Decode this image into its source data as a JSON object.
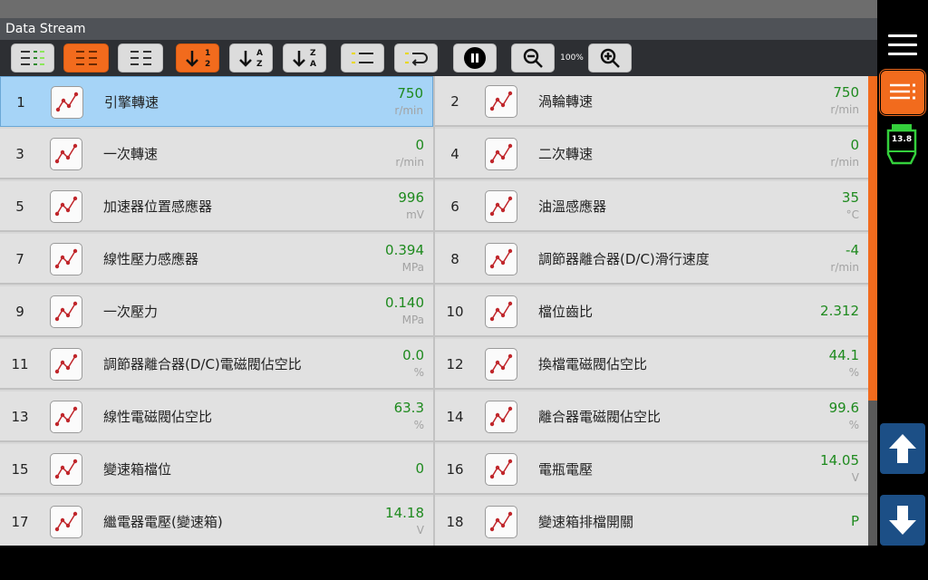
{
  "window": {
    "title": "Data Stream"
  },
  "toolbar": {
    "zoom": "100%",
    "buttons": [
      {
        "name": "view-list-3col-button",
        "icon": "three-column-list-icon",
        "active": false
      },
      {
        "name": "view-list-2col-button",
        "icon": "two-column-list-icon",
        "active": true
      },
      {
        "name": "view-list-compact-button",
        "icon": "compact-list-icon",
        "active": false
      },
      {
        "name": "sort-numeric-button",
        "icon": "sort-numeric-icon",
        "active": true
      },
      {
        "name": "sort-az-button",
        "icon": "sort-az-icon",
        "active": false
      },
      {
        "name": "sort-za-button",
        "icon": "sort-za-icon",
        "active": false
      },
      {
        "name": "select-items-button",
        "icon": "checklist-icon",
        "active": false
      },
      {
        "name": "undo-selection-button",
        "icon": "undo-list-icon",
        "active": false
      },
      {
        "name": "pause-button",
        "icon": "pause-icon",
        "active": false
      },
      {
        "name": "zoom-out-button",
        "icon": "zoom-out-icon",
        "active": false
      },
      {
        "name": "zoom-in-button",
        "icon": "zoom-in-icon",
        "active": false
      }
    ]
  },
  "colors": {
    "accent": "#f26b1d",
    "value_green": "#1e8a1e",
    "selected_row": "#a6d4f7",
    "nav_blue": "#1c4f86"
  },
  "rows": [
    {
      "num": "1",
      "name": "引擎轉速",
      "value": "750",
      "unit": "r/min",
      "selected": true
    },
    {
      "num": "2",
      "name": "渦輪轉速",
      "value": "750",
      "unit": "r/min"
    },
    {
      "num": "3",
      "name": "一次轉速",
      "value": "0",
      "unit": "r/min"
    },
    {
      "num": "4",
      "name": "二次轉速",
      "value": "0",
      "unit": "r/min"
    },
    {
      "num": "5",
      "name": "加速器位置感應器",
      "value": "996",
      "unit": "mV"
    },
    {
      "num": "6",
      "name": "油溫感應器",
      "value": "35",
      "unit": "°C"
    },
    {
      "num": "7",
      "name": "線性壓力感應器",
      "value": "0.394",
      "unit": "MPa"
    },
    {
      "num": "8",
      "name": "調節器離合器(D/C)滑行速度",
      "value": "-4",
      "unit": "r/min"
    },
    {
      "num": "9",
      "name": "一次壓力",
      "value": "0.140",
      "unit": "MPa"
    },
    {
      "num": "10",
      "name": "檔位齒比",
      "value": "2.312",
      "unit": ""
    },
    {
      "num": "11",
      "name": "調節器離合器(D/C)電磁閥佔空比",
      "value": "0.0",
      "unit": "%"
    },
    {
      "num": "12",
      "name": "換檔電磁閥佔空比",
      "value": "44.1",
      "unit": "%"
    },
    {
      "num": "13",
      "name": "線性電磁閥佔空比",
      "value": "63.3",
      "unit": "%"
    },
    {
      "num": "14",
      "name": "離合器電磁閥佔空比",
      "value": "99.6",
      "unit": "%"
    },
    {
      "num": "15",
      "name": "變速箱檔位",
      "value": "0",
      "unit": ""
    },
    {
      "num": "16",
      "name": "電瓶電壓",
      "value": "14.05",
      "unit": "V"
    },
    {
      "num": "17",
      "name": "繼電器電壓(變速箱)",
      "value": "14.18",
      "unit": "V"
    },
    {
      "num": "18",
      "name": "變速箱排檔開關",
      "value": "P",
      "unit": ""
    }
  ],
  "sidebar": {
    "battery_voltage": "13.8",
    "menu_icon": "hamburger-menu-icon",
    "list_icon": "list-view-icon",
    "scroll_up_icon": "arrow-up-icon",
    "scroll_down_icon": "arrow-down-icon"
  }
}
